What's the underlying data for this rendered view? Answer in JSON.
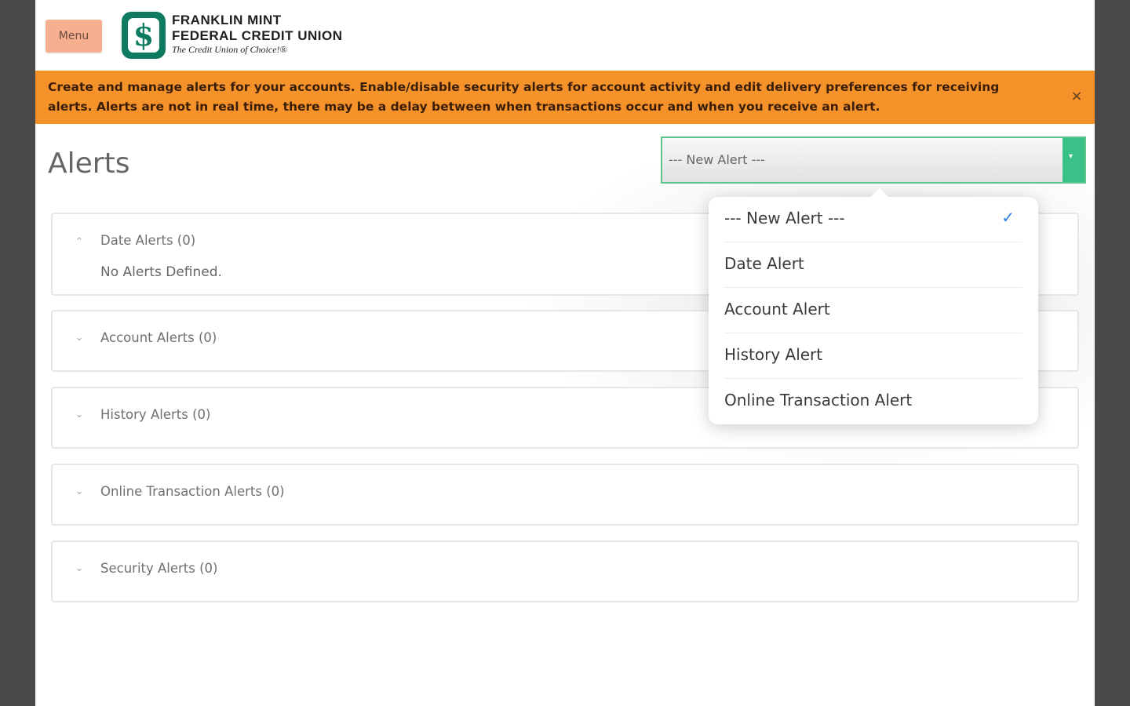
{
  "header": {
    "menu_label": "Menu",
    "logo": {
      "line1": "FRANKLIN MINT",
      "line2": "FEDERAL CREDIT UNION",
      "tagline": "The Credit Union of Choice!®"
    }
  },
  "banner": {
    "text": "Create and manage alerts for your accounts. Enable/disable security alerts for account activity and edit delivery preferences for receiving alerts. Alerts are not in real time, there may be a delay between when transactions occur and when you receive an alert.",
    "close_glyph": "×"
  },
  "page": {
    "title": "Alerts"
  },
  "new_alert_select": {
    "selected": "--- New Alert ---",
    "caret": "▾"
  },
  "panels": [
    {
      "title": "Date Alerts (0)",
      "expanded": true,
      "chevron": "⌃",
      "body": "No Alerts Defined."
    },
    {
      "title": "Account Alerts (0)",
      "expanded": false,
      "chevron": "⌄"
    },
    {
      "title": "History Alerts (0)",
      "expanded": false,
      "chevron": "⌄"
    },
    {
      "title": "Online Transaction Alerts (0)",
      "expanded": false,
      "chevron": "⌄"
    },
    {
      "title": "Security Alerts (0)",
      "expanded": false,
      "chevron": "⌄"
    }
  ],
  "dropdown": {
    "check_glyph": "✓",
    "options": [
      {
        "label": "--- New Alert ---",
        "selected": true
      },
      {
        "label": "Date Alert",
        "selected": false
      },
      {
        "label": "Account Alert",
        "selected": false
      },
      {
        "label": "History Alert",
        "selected": false
      },
      {
        "label": "Online Transaction Alert",
        "selected": false
      }
    ]
  },
  "colors": {
    "banner": "#f5922a",
    "brand_green": "#0e7a5f",
    "select_accent": "#3cc08a",
    "menu_button": "#f6b08f",
    "check": "#2a7de1"
  },
  "icons": {
    "close": "close-icon",
    "chevron_up": "chevron-up-icon",
    "chevron_down": "chevron-down-icon",
    "check": "checkmark-icon",
    "caret": "caret-down-icon"
  }
}
